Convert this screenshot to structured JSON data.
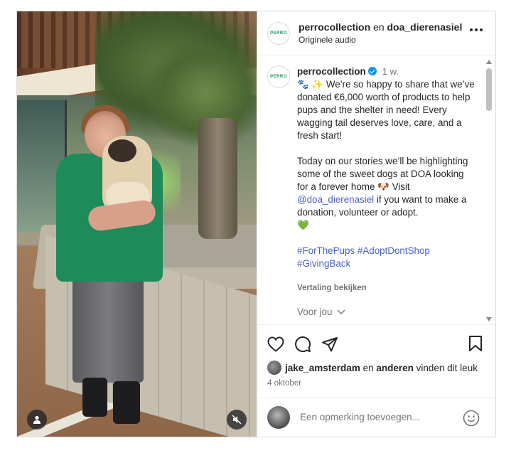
{
  "header": {
    "logo_text": "PERRO",
    "username": "perrocollection",
    "connector": " en ",
    "collab_username": "doa_dierenasiel",
    "audio": "Originele audio"
  },
  "caption": {
    "username": "perrocollection",
    "time": "1 w.",
    "emoji_prefix": "🐾 ✨",
    "text1": "We’re so happy to share that we’ve donated €6,000 worth of products to help pups and the shelter in need! Every wagging tail deserves love, care, and a fresh start!",
    "text2a": "Today on our stories we’ll be highlighting some of the sweet dogs at DOA looking for a forever home",
    "text2_emoji": "🐶",
    "text2b": "Visit",
    "mention": "@doa_dierenasiel",
    "text2c": "if you want to make a donation, volunteer or adopt.",
    "heart": "💚",
    "hashtag1": "#ForThePups",
    "hashtag2": "#AdoptDontShop",
    "hashtag3": "#GivingBack",
    "translate": "Vertaling bekijken",
    "for_you": "Voor jou"
  },
  "likes": {
    "user": "jake_amsterdam",
    "connector": " en ",
    "others": "anderen",
    "suffix": " vinden dit leuk"
  },
  "date": "4 oktober",
  "comment_box": {
    "placeholder": "Een opmerking toevoegen..."
  },
  "icons": [
    "user-icon",
    "mute-icon",
    "more-icon",
    "heart-icon",
    "comment-icon",
    "share-icon",
    "bookmark-icon",
    "emoji-icon",
    "chevron-down-icon",
    "verified-icon"
  ],
  "colors": {
    "link": "#4a5fc1",
    "verified": "#0095f6",
    "muted": "#737373"
  }
}
